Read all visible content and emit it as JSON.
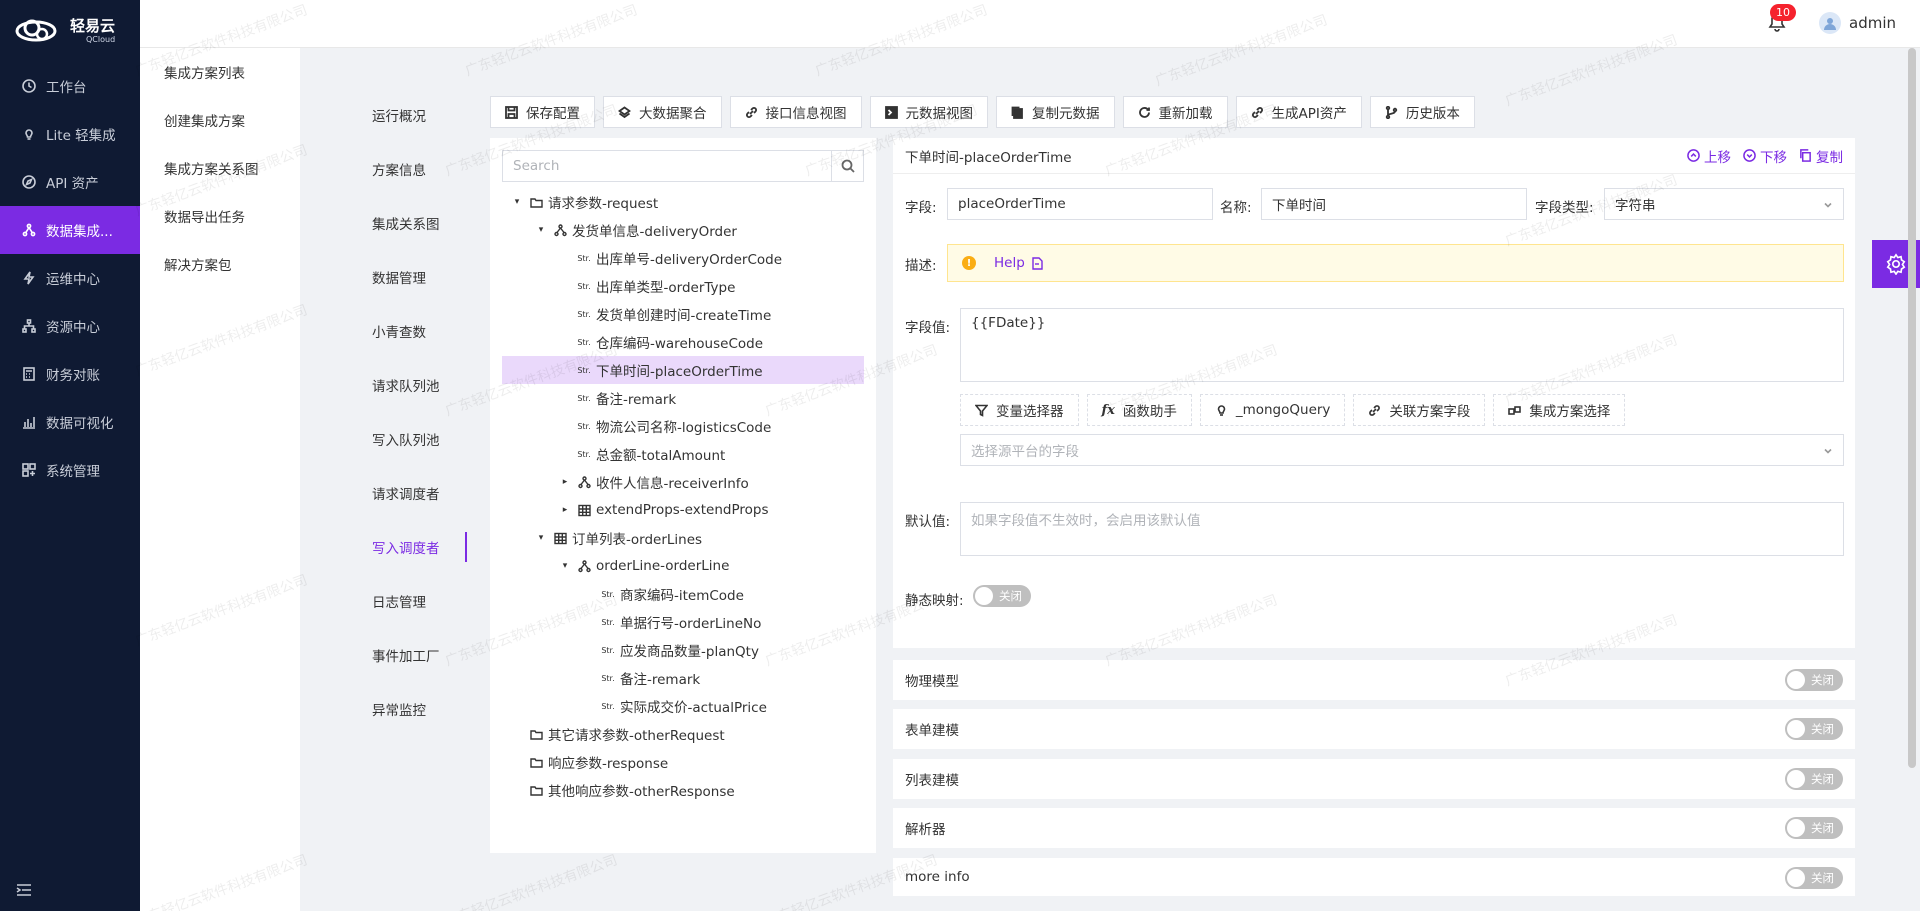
{
  "brand": {
    "name": "轻易云",
    "sub": "QCloud"
  },
  "nav": [
    {
      "label": "工作台",
      "icon": "clock-icon"
    },
    {
      "label": "Lite 轻集成",
      "icon": "bulb-icon"
    },
    {
      "label": "API 资产",
      "icon": "compass-icon"
    },
    {
      "label": "数据集成...",
      "icon": "network-icon",
      "active": true
    },
    {
      "label": "运维中心",
      "icon": "bolt-icon"
    },
    {
      "label": "资源中心",
      "icon": "hierarchy-icon"
    },
    {
      "label": "财务对账",
      "icon": "calculator-icon"
    },
    {
      "label": "数据可视化",
      "icon": "bar-chart-icon"
    },
    {
      "label": "系统管理",
      "icon": "grid-icon"
    }
  ],
  "header": {
    "badge": "10",
    "user": "admin"
  },
  "submenu": [
    "集成方案列表",
    "创建集成方案",
    "集成方案关系图",
    "数据导出任务",
    "解决方案包"
  ],
  "tabs": [
    "运行概况",
    "方案信息",
    "集成关系图",
    "数据管理",
    "小青查数",
    "请求队列池",
    "写入队列池",
    "请求调度者",
    "写入调度者",
    "日志管理",
    "事件加工厂",
    "异常监控"
  ],
  "toolbar": [
    "保存配置",
    "大数据聚合",
    "接口信息视图",
    "元数据视图",
    "复制元数据",
    "重新加载",
    "生成API资产",
    "历史版本"
  ],
  "search": {
    "placeholder": "Search"
  },
  "tree": [
    {
      "label": "请求参数-request",
      "caret": "▾",
      "icon": "folder",
      "level": 0
    },
    {
      "label": "发货单信息-deliveryOrder",
      "caret": "▾",
      "icon": "object",
      "level": 1
    },
    {
      "label": "出库单号-deliveryOrderCode",
      "caret": "",
      "icon": "str",
      "level": 2
    },
    {
      "label": "出库单类型-orderType",
      "caret": "",
      "icon": "str",
      "level": 2
    },
    {
      "label": "发货单创建时间-createTime",
      "caret": "",
      "icon": "str",
      "level": 2
    },
    {
      "label": "仓库编码-warehouseCode",
      "caret": "",
      "icon": "str",
      "level": 2
    },
    {
      "label": "下单时间-placeOrderTime",
      "caret": "",
      "icon": "str",
      "level": 2,
      "selected": true
    },
    {
      "label": "备注-remark",
      "caret": "",
      "icon": "str",
      "level": 2
    },
    {
      "label": "物流公司名称-logisticsCode",
      "caret": "",
      "icon": "str",
      "level": 2
    },
    {
      "label": "总金额-totalAmount",
      "caret": "",
      "icon": "str",
      "level": 2
    },
    {
      "label": "收件人信息-receiverInfo",
      "caret": "▸",
      "icon": "object",
      "level": 2
    },
    {
      "label": "extendProps-extendProps",
      "caret": "▸",
      "icon": "table",
      "level": 2
    },
    {
      "label": "订单列表-orderLines",
      "caret": "▾",
      "icon": "table",
      "level": 1
    },
    {
      "label": "orderLine-orderLine",
      "caret": "▾",
      "icon": "object",
      "level": 2
    },
    {
      "label": "商家编码-itemCode",
      "caret": "",
      "icon": "str",
      "level": 3
    },
    {
      "label": "单据行号-orderLineNo",
      "caret": "",
      "icon": "str",
      "level": 3
    },
    {
      "label": "应发商品数量-planQty",
      "caret": "",
      "icon": "str",
      "level": 3
    },
    {
      "label": "备注-remark",
      "caret": "",
      "icon": "str",
      "level": 3
    },
    {
      "label": "实际成交价-actualPrice",
      "caret": "",
      "icon": "str",
      "level": 3
    },
    {
      "label": "其它请求参数-otherRequest",
      "caret": "",
      "icon": "folder",
      "level": 0
    },
    {
      "label": "响应参数-response",
      "caret": "",
      "icon": "folder",
      "level": 0
    },
    {
      "label": "其他响应参数-otherResponse",
      "caret": "",
      "icon": "folder",
      "level": 0
    }
  ],
  "str_tag": "Str.",
  "detail": {
    "title": "下单时间-placeOrderTime",
    "actions": {
      "up": "上移",
      "down": "下移",
      "copy": "复制"
    },
    "field_label": "字段:",
    "field_value": "placeOrderTime",
    "name_label": "名称:",
    "name_value": "下单时间",
    "type_label": "字段类型:",
    "type_value": "字符串",
    "desc_label": "描述:",
    "help_text": "Help",
    "value_label": "字段值:",
    "value_text": "{{FDate}}",
    "helpers": [
      "变量选择器",
      "函数助手",
      "_mongoQuery",
      "关联方案字段",
      "集成方案选择"
    ],
    "source_placeholder": "选择源平台的字段",
    "default_label": "默认值:",
    "default_placeholder": "如果字段值不生效时，会启用该默认值",
    "static_label": "静态映射:",
    "off_text": "关闭"
  },
  "sections": [
    "物理模型",
    "表单建模",
    "列表建模",
    "解析器",
    "more info"
  ],
  "watermark": "广东轻亿云软件科技有限公司"
}
